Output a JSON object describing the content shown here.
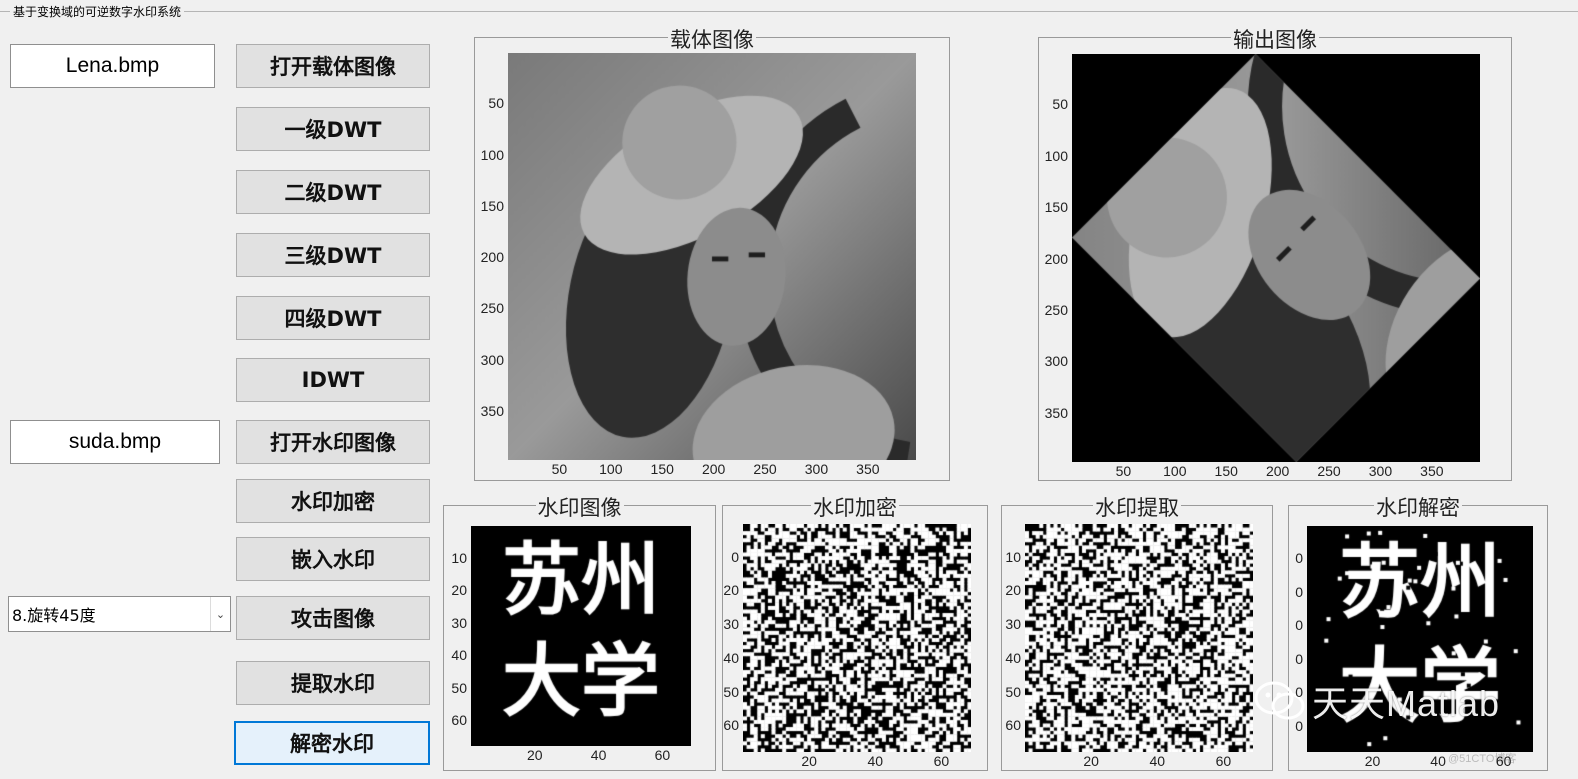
{
  "window": {
    "frame_title": "基于变换域的可逆数字水印系统"
  },
  "inputs": {
    "carrier_file": "Lena.bmp",
    "watermark_file": "suda.bmp",
    "attack_select": "8.旋转45度"
  },
  "buttons": {
    "open_carrier": "打开载体图像",
    "dwt1": "一级DWT",
    "dwt2": "二级DWT",
    "dwt3": "三级DWT",
    "dwt4": "四级DWT",
    "idwt": "IDWT",
    "open_watermark": "打开水印图像",
    "encrypt": "水印加密",
    "embed": "嵌入水印",
    "attack": "攻击图像",
    "extract": "提取水印",
    "decrypt": "解密水印"
  },
  "panels": {
    "carrier": {
      "title": "载体图像",
      "yticks": [
        "50",
        "100",
        "150",
        "200",
        "250",
        "300",
        "350"
      ],
      "xticks": [
        "50",
        "100",
        "150",
        "200",
        "250",
        "300",
        "350"
      ]
    },
    "output": {
      "title": "输出图像",
      "yticks": [
        "50",
        "100",
        "150",
        "200",
        "250",
        "300",
        "350"
      ],
      "xticks": [
        "50",
        "100",
        "150",
        "200",
        "250",
        "300",
        "350"
      ]
    },
    "wm_image": {
      "title": "水印图像",
      "yticks": [
        "10",
        "20",
        "30",
        "40",
        "50",
        "60"
      ],
      "xticks": [
        "20",
        "40",
        "60"
      ],
      "glyph_top": "苏州",
      "glyph_bottom": "大学"
    },
    "wm_encrypt": {
      "title": "水印加密",
      "yticks": [
        "0",
        "20",
        "30",
        "40",
        "50",
        "60"
      ],
      "xticks": [
        "20",
        "40",
        "60"
      ]
    },
    "wm_extract": {
      "title": "水印提取",
      "yticks": [
        "10",
        "20",
        "30",
        "40",
        "50",
        "60"
      ],
      "xticks": [
        "20",
        "40",
        "60"
      ]
    },
    "wm_decrypt": {
      "title": "水印解密",
      "yticks": [
        "0",
        "0",
        "0",
        "0",
        "0",
        "0"
      ],
      "xticks": [
        "20",
        "40",
        "60"
      ],
      "glyph_top": "苏州",
      "glyph_bottom": "大学"
    }
  },
  "overlay": {
    "watermark_text": "天天Matlab",
    "credit": "@51CTO博客"
  },
  "colors": {
    "accent": "#0078d7",
    "axes_bg": "#000000"
  },
  "icons": {
    "select_arrow": "chevron-down-icon",
    "wechat": "wechat-icon"
  }
}
